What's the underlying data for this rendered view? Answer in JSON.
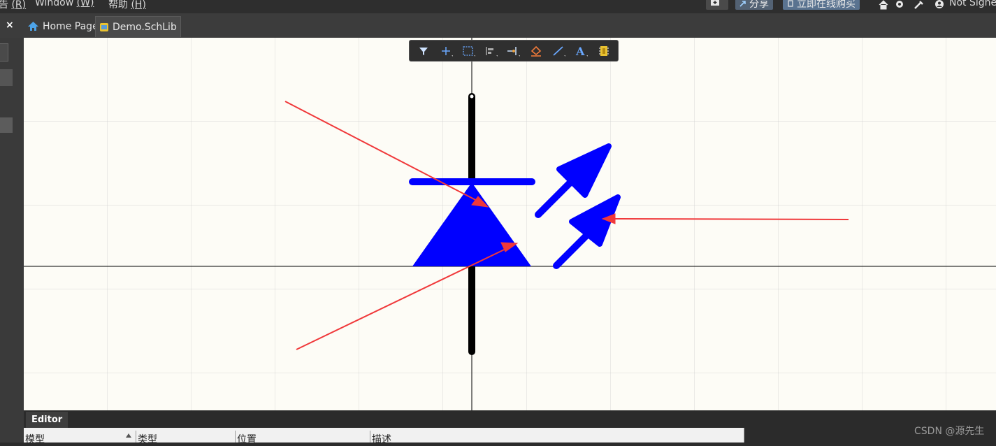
{
  "menu": {
    "items": [
      {
        "label": "告",
        "key": "(R)"
      },
      {
        "label": "Window ",
        "key": "(W)"
      },
      {
        "label": "帮助 ",
        "key": "(H)"
      }
    ]
  },
  "topbar": {
    "share_label": "分享",
    "buy_label": "立即在线购买",
    "account_label": "Not Signe"
  },
  "tabs": [
    {
      "label": "Home Page",
      "icon": "home-icon"
    },
    {
      "label": "Demo.SchLib",
      "icon": "schlib-document-icon"
    }
  ],
  "close_glyph": "×",
  "canvas_toolbar": {
    "tools": [
      "filter-icon",
      "add-cross-icon",
      "select-rect-icon",
      "align-icon",
      "place-pin-icon",
      "eraser-icon",
      "line-icon",
      "text-icon",
      "component-icon"
    ]
  },
  "colors": {
    "symbol": "#0000ff",
    "pin": "#000000",
    "annotation_arrow": "#f0383a",
    "canvas_bg": "#fdfcf6"
  },
  "editor": {
    "tab_label": "Editor",
    "columns": [
      "模型",
      "类型",
      "位置",
      "描述"
    ]
  },
  "watermark": "CSDN @源先生"
}
